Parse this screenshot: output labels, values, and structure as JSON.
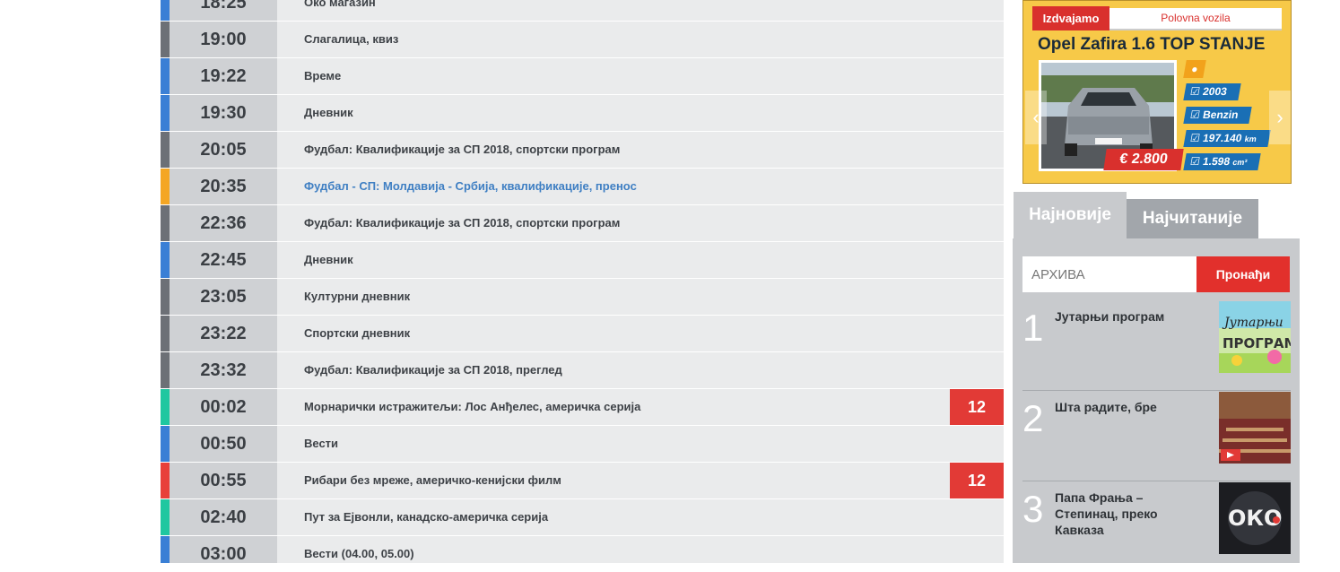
{
  "schedule": [
    {
      "time": "18:25",
      "title": "Око магазин",
      "color": "#3a7fd5",
      "age": ""
    },
    {
      "time": "19:00",
      "title": "Слагалица, квиз",
      "color": "#6c7076",
      "age": ""
    },
    {
      "time": "19:22",
      "title": "Време",
      "color": "#3a7fd5",
      "age": ""
    },
    {
      "time": "19:30",
      "title": "Дневник",
      "color": "#3a7fd5",
      "age": ""
    },
    {
      "time": "20:05",
      "title": "Фудбал: Квалификације за СП 2018, спортски програм",
      "color": "#6c7076",
      "age": ""
    },
    {
      "time": "20:35",
      "title": "Фудбал - СП: Молдавија - Србија, квалификације, пренос",
      "color": "#f4a623",
      "age": "",
      "link": true
    },
    {
      "time": "22:36",
      "title": "Фудбал: Квалификације за СП 2018, спортски програм",
      "color": "#6c7076",
      "age": ""
    },
    {
      "time": "22:45",
      "title": "Дневник",
      "color": "#3a7fd5",
      "age": ""
    },
    {
      "time": "23:05",
      "title": "Културни дневник",
      "color": "#6c7076",
      "age": ""
    },
    {
      "time": "23:22",
      "title": "Спортски дневник",
      "color": "#6c7076",
      "age": ""
    },
    {
      "time": "23:32",
      "title": "Фудбал: Квалификације за СП 2018, преглед",
      "color": "#6c7076",
      "age": ""
    },
    {
      "time": "00:02",
      "title": "Морнарички истражитељи: Лос Анђелес, америчка серија",
      "color": "#1fc7a0",
      "age": "12"
    },
    {
      "time": "00:50",
      "title": "Вести",
      "color": "#3a7fd5",
      "age": ""
    },
    {
      "time": "00:55",
      "title": "Рибари без мреже, америчко-кенијски филм",
      "color": "#e8403a",
      "age": "12"
    },
    {
      "time": "02:40",
      "title": "Пут за Ејвонли, канадско-америчка серија",
      "color": "#1fc7a0",
      "age": ""
    },
    {
      "time": "03:00",
      "title": "Вести (04.00, 05.00)",
      "color": "#3a7fd5",
      "age": ""
    }
  ],
  "ad": {
    "featured_label": "Izdvajamo",
    "category_label": "Polovna vozila",
    "car_title": "Opel Zafira 1.6 TOP STANJE",
    "price": "€ 2.800",
    "specs": [
      {
        "icon": "check-icon",
        "value": "2003",
        "unit": ""
      },
      {
        "icon": "check-icon",
        "value": "Benzin",
        "unit": ""
      },
      {
        "icon": "check-icon",
        "value": "197.140",
        "unit": "km"
      },
      {
        "icon": "check-icon",
        "value": "1.598",
        "unit": "cm³"
      }
    ]
  },
  "tabs": [
    {
      "label": "Најновије",
      "active": true
    },
    {
      "label": "Најчитаније",
      "active": false
    }
  ],
  "search": {
    "placeholder": "АРХИВА",
    "button_label": "Пронађи"
  },
  "popular": [
    {
      "rank": "1",
      "title": "Јутарњи програм",
      "thumb_text": "Јутарњи ПРОГРАМ"
    },
    {
      "rank": "2",
      "title": "Шта радите, бре",
      "thumb_text": ""
    },
    {
      "rank": "3",
      "title": "Папа Фрања – Степинац, преко Кавказа",
      "thumb_text": "ОКО"
    }
  ],
  "colors": {
    "age_badge": "#e23a36",
    "search_button": "#e2302c",
    "sidebar_bg": "#c8cacd"
  }
}
